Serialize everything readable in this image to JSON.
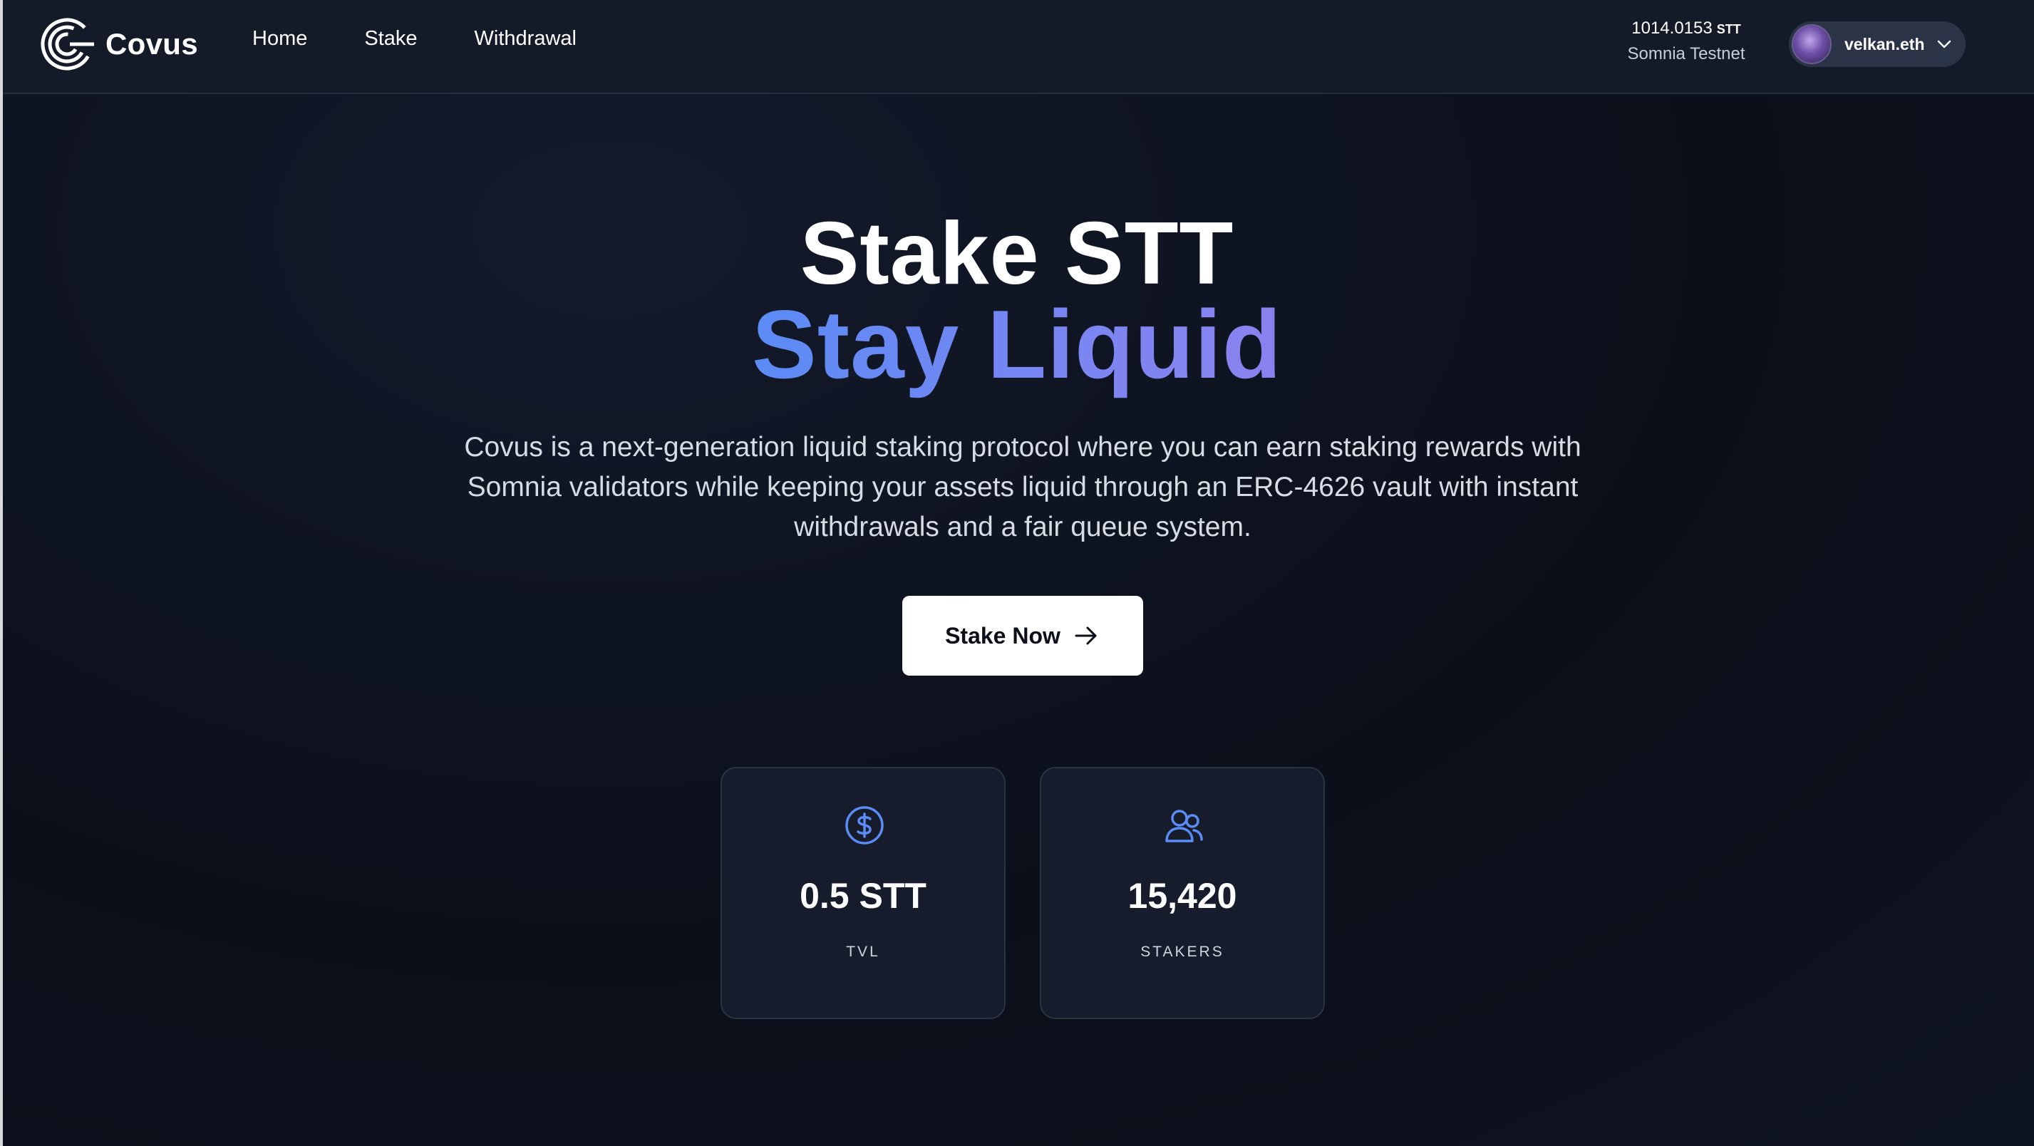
{
  "app": {
    "name": "Covus"
  },
  "nav": {
    "items": [
      {
        "label": "Home"
      },
      {
        "label": "Stake"
      },
      {
        "label": "Withdrawal"
      }
    ]
  },
  "wallet": {
    "balance": "1014.0153",
    "unit": "STT",
    "network": "Somnia Testnet",
    "account_name": "velkan.eth"
  },
  "hero": {
    "title_line1": "Stake STT",
    "title_line2": "Stay Liquid",
    "description": "Covus is a next-generation liquid staking protocol where you can earn staking rewards with Somnia validators while keeping your assets liquid through an ERC-4626 vault with instant withdrawals and a fair queue system.",
    "cta_label": "Stake Now"
  },
  "stats": [
    {
      "icon": "dollar-circle-icon",
      "value": "0.5 STT",
      "label": "TVL"
    },
    {
      "icon": "users-icon",
      "value": "15,420",
      "label": "STAKERS"
    }
  ],
  "colors": {
    "background": "#0b0f1a",
    "header": "#141a28",
    "accent_gradient_start": "#5b8bf5",
    "accent_gradient_end": "#8a82ee",
    "icon_accent": "#5b8bf5",
    "card": "#161c2b"
  }
}
